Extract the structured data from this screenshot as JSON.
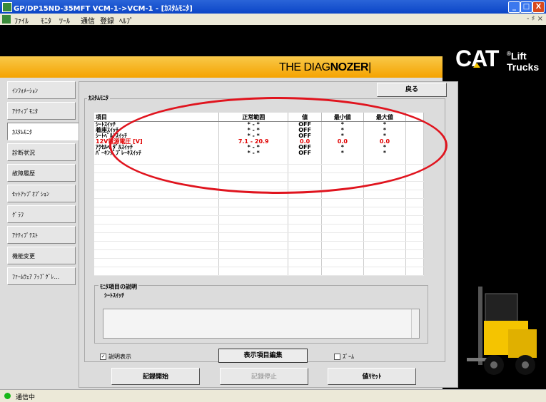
{
  "window": {
    "title": "GP/DP15ND-35MFT VCM-1->VCM-1 - [ｶｽﾀﾑﾓﾆﾀ]",
    "min": "_",
    "max": "□",
    "close": "X"
  },
  "menu": [
    "ﾌｧｲﾙ",
    "ﾓﾆﾀ",
    "ﾂｰﾙ",
    "通信",
    "登録",
    "ﾍﾙﾌﾟ"
  ],
  "menu_mdi": "- ♯ ×",
  "banner": {
    "brand_prefix": "THE DIAG",
    "brand_suffix": "NOZER",
    "logo": "CAT",
    "logo_sub1": "Lift",
    "logo_sub2": "Trucks",
    "logo_reg": "®"
  },
  "sidebar": [
    {
      "label": "ｲﾝﾌｫﾒｰｼｮﾝ",
      "active": false
    },
    {
      "label": "ｱｸﾃｨﾌﾞﾓﾆﾀ",
      "active": false
    },
    {
      "label": "ｶｽﾀﾑﾓﾆﾀ",
      "active": true
    },
    {
      "label": "診断状況",
      "active": false
    },
    {
      "label": "故障履歴",
      "active": false
    },
    {
      "label": "ｾｯﾄｱｯﾌﾟｵﾌﾟｼｮﾝ",
      "active": false
    },
    {
      "label": "ｸﾞﾗﾌ",
      "active": false
    },
    {
      "label": "ｱｸﾃｨﾌﾞﾃｽﾄ",
      "active": false
    },
    {
      "label": "機能変更",
      "active": false
    },
    {
      "label": "ﾌｧｰﾑｳｪｱ ｱｯﾌﾟｸﾞﾚ...",
      "active": false
    }
  ],
  "back_button": "戻る",
  "monitor": {
    "title": "ｶｽﾀﾑﾓﾆﾀ",
    "columns": [
      "項目",
      "正常範囲",
      "値",
      "最小値",
      "最大値"
    ],
    "rows": [
      {
        "item": "ｼｰﾄｽｲｯﾁ",
        "range": "*  -  *",
        "value": "OFF",
        "min": "*",
        "max": "*",
        "alert": false
      },
      {
        "item": "着座ｽｲｯﾁ",
        "range": "*  -  *",
        "value": "OFF",
        "min": "*",
        "max": "*",
        "alert": false
      },
      {
        "item": "ｼｰﾄﾍﾞﾙﾄｽｲｯﾁ",
        "range": "*  -  *",
        "value": "OFF",
        "min": "*",
        "max": "*",
        "alert": false
      },
      {
        "item": "12V電源電圧 [V]",
        "range": "7.1  -  20.9",
        "value": "0.0",
        "min": "0.0",
        "max": "0.0",
        "alert": true
      },
      {
        "item": "ｱｸｾﾙﾍﾟﾀﾞﾙｽｲｯﾁ",
        "range": "*  -  *",
        "value": "OFF",
        "min": "*",
        "max": "*",
        "alert": false
      },
      {
        "item": "ﾊﾟｰｷﾝｸﾞﾌﾞﾚｰｷｽｲｯﾁ",
        "range": "*  -  *",
        "value": "OFF",
        "min": "*",
        "max": "*",
        "alert": false
      }
    ],
    "empty_rows": 14
  },
  "description": {
    "label": "ﾓﾆﾀ項目の説明",
    "item": "ｼｰﾄｽｲｯﾁ",
    "text": ""
  },
  "controls": {
    "show_desc_label": "説明表示",
    "show_desc_checked": "✓",
    "edit_display_button": "表示項目編集",
    "zoom_label": "ｽﾞｰﾑ",
    "record_start_button": "記録開始",
    "record_stop_button": "記録停止",
    "reset_button": "値ﾘｾｯﾄ"
  },
  "status": {
    "text": "通信中"
  },
  "colors": {
    "accent_yellow": "#f5a300",
    "alert_red": "#e00000",
    "annotation_red": "#e0141e"
  }
}
